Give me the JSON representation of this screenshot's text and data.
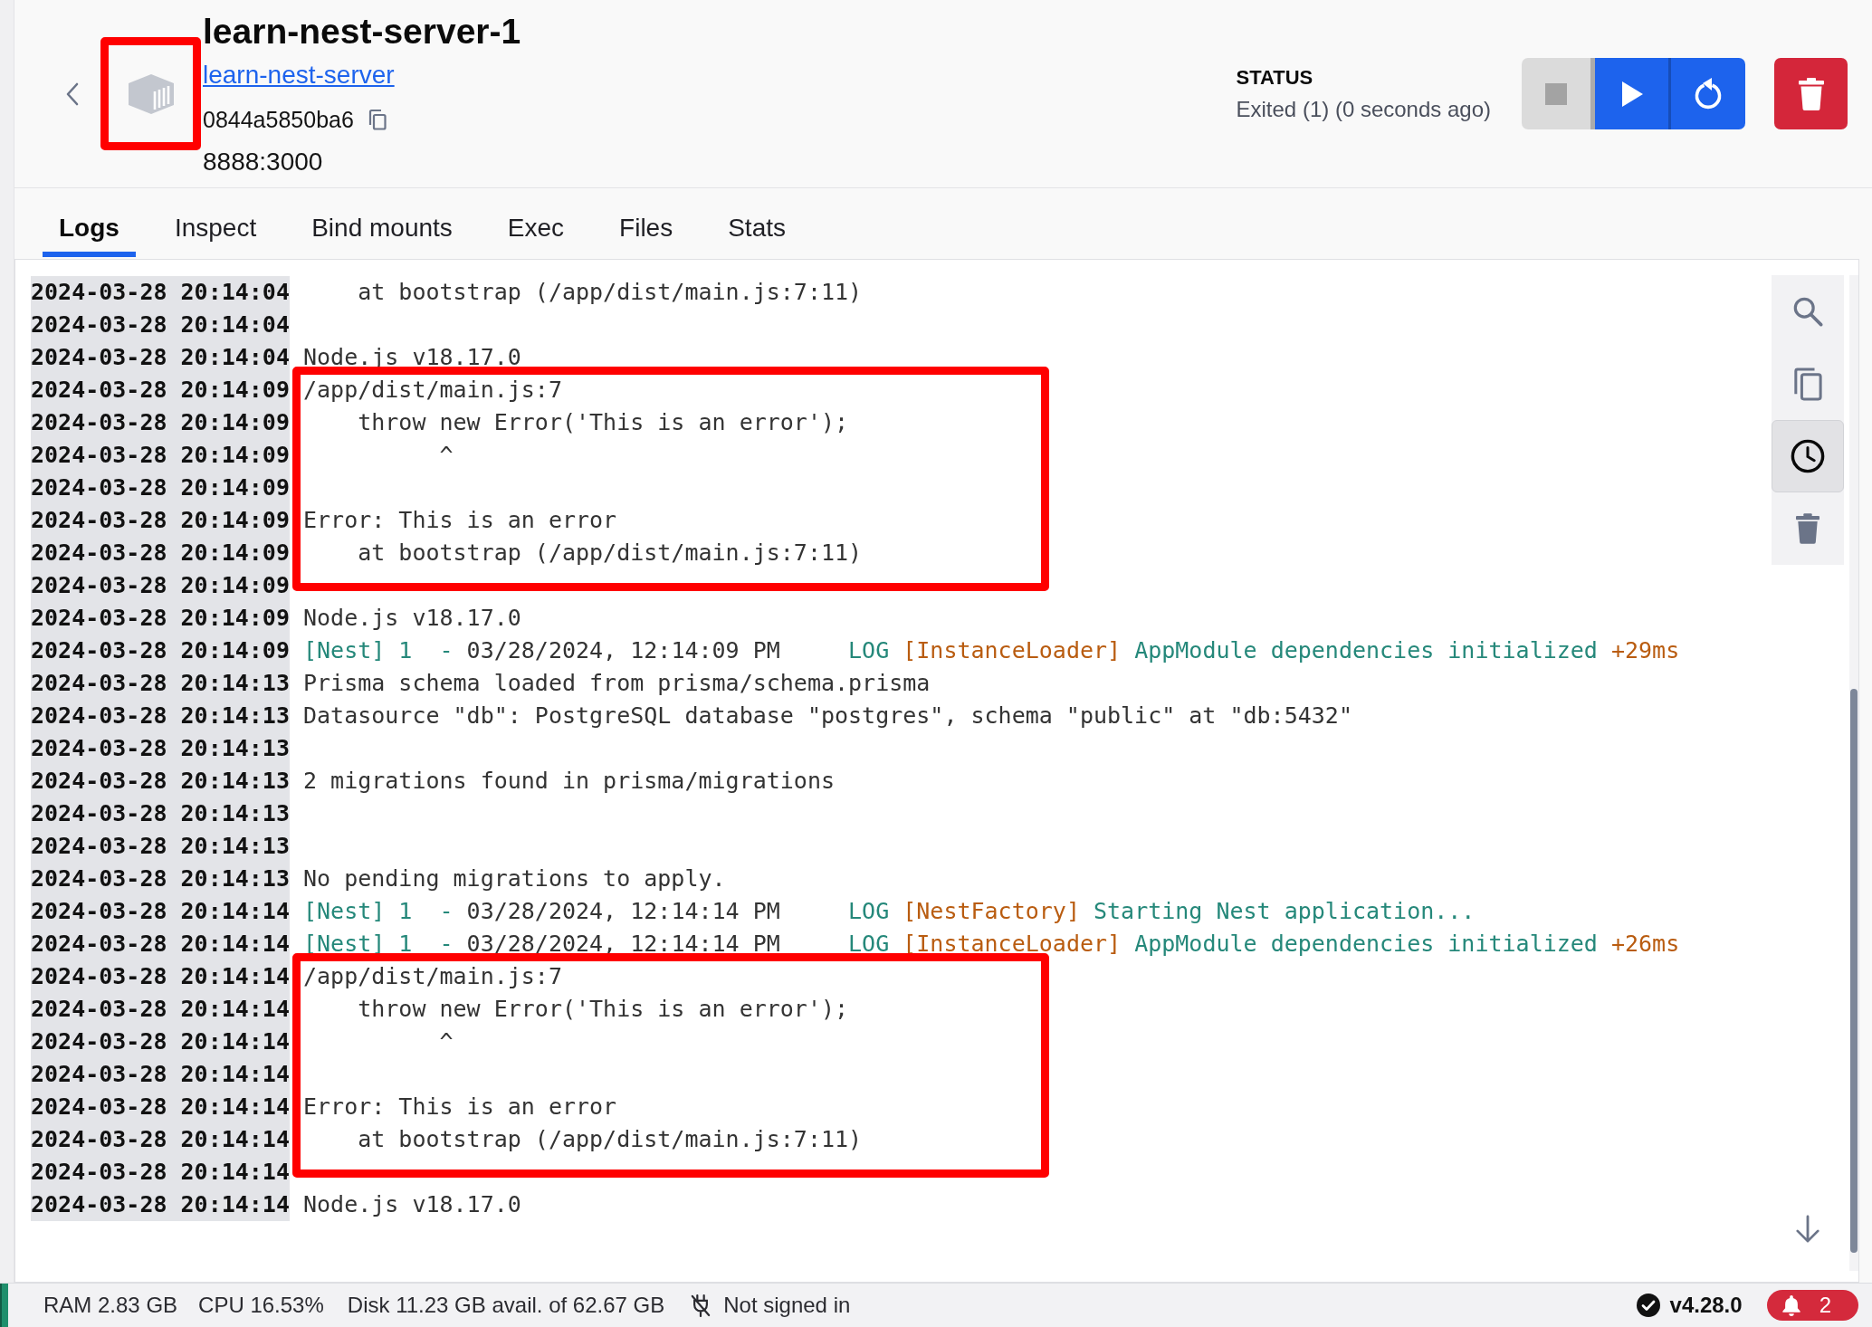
{
  "container": {
    "name": "learn-nest-server-1",
    "image": "learn-nest-server",
    "id": "0844a5850ba6",
    "ports": "8888:3000",
    "framed": true
  },
  "status": {
    "label": "STATUS",
    "value": "Exited (1) (0 seconds ago)"
  },
  "actions": [
    {
      "kind": "stop",
      "disabled": true
    },
    {
      "kind": "start",
      "disabled": false
    },
    {
      "kind": "restart",
      "disabled": false
    },
    {
      "kind": "delete",
      "disabled": false
    }
  ],
  "tabs": [
    {
      "label": "Logs",
      "selected": true
    },
    {
      "label": "Inspect",
      "selected": false
    },
    {
      "label": "Bind mounts",
      "selected": false
    },
    {
      "label": "Exec",
      "selected": false
    },
    {
      "label": "Files",
      "selected": false
    },
    {
      "label": "Stats",
      "selected": false
    }
  ],
  "log_tools": [
    {
      "kind": "search",
      "selected": false
    },
    {
      "kind": "copy",
      "selected": false
    },
    {
      "kind": "timestamps",
      "selected": true
    },
    {
      "kind": "clear",
      "selected": false
    }
  ],
  "log_blocks": [
    {
      "framed": false,
      "lines": [
        {
          "time": "2024-03-28 20:14:04",
          "text": "    at bootstrap (/app/dist/main.js:7:11)"
        },
        {
          "time": "2024-03-28 20:14:04"
        },
        {
          "time": "2024-03-28 20:14:04",
          "text": "Node.js v18.17.0"
        }
      ]
    },
    {
      "framed": true,
      "lines": [
        {
          "time": "2024-03-28 20:14:09",
          "text": "/app/dist/main.js:7"
        },
        {
          "time": "2024-03-28 20:14:09",
          "text": "    throw new Error('This is an error');"
        },
        {
          "time": "2024-03-28 20:14:09",
          "text": "          ^"
        },
        {
          "time": "2024-03-28 20:14:09"
        },
        {
          "time": "2024-03-28 20:14:09",
          "text": "Error: This is an error"
        },
        {
          "time": "2024-03-28 20:14:09",
          "text": "    at bootstrap (/app/dist/main.js:7:11)"
        },
        {
          "time": "2024-03-28 20:14:09"
        }
      ]
    },
    {
      "framed": false,
      "lines": [
        {
          "time": "2024-03-28 20:14:09",
          "text": "Node.js v18.17.0"
        },
        {
          "time": "2024-03-28 20:14:09",
          "parts": [
            {
              "text": "[Nest] 1  - ",
              "color": "#25887a"
            },
            {
              "text": "03/28/2024, 12:14:09 PM     "
            },
            {
              "text": "LOG ",
              "color": "#25887a"
            },
            {
              "text": "[InstanceLoader] ",
              "color": "#b95c10"
            },
            {
              "text": "AppModule dependencies initialized ",
              "color": "#25887a"
            },
            {
              "text": "+29ms",
              "color": "#b95c10"
            }
          ]
        },
        {
          "time": "2024-03-28 20:14:13",
          "text": "Prisma schema loaded from prisma/schema.prisma"
        },
        {
          "time": "2024-03-28 20:14:13",
          "text": "Datasource \"db\": PostgreSQL database \"postgres\", schema \"public\" at \"db:5432\""
        },
        {
          "time": "2024-03-28 20:14:13"
        },
        {
          "time": "2024-03-28 20:14:13",
          "text": "2 migrations found in prisma/migrations"
        },
        {
          "time": "2024-03-28 20:14:13"
        },
        {
          "time": "2024-03-28 20:14:13"
        },
        {
          "time": "2024-03-28 20:14:13",
          "text": "No pending migrations to apply."
        },
        {
          "time": "2024-03-28 20:14:14",
          "parts": [
            {
              "text": "[Nest] 1  - ",
              "color": "#25887a"
            },
            {
              "text": "03/28/2024, 12:14:14 PM     "
            },
            {
              "text": "LOG ",
              "color": "#25887a"
            },
            {
              "text": "[NestFactory] ",
              "color": "#b95c10"
            },
            {
              "text": "Starting Nest application...",
              "color": "#25887a"
            }
          ]
        },
        {
          "time": "2024-03-28 20:14:14",
          "parts": [
            {
              "text": "[Nest] 1  - ",
              "color": "#25887a"
            },
            {
              "text": "03/28/2024, 12:14:14 PM     "
            },
            {
              "text": "LOG ",
              "color": "#25887a"
            },
            {
              "text": "[InstanceLoader] ",
              "color": "#b95c10"
            },
            {
              "text": "AppModule dependencies initialized ",
              "color": "#25887a"
            },
            {
              "text": "+26ms",
              "color": "#b95c10"
            }
          ]
        }
      ]
    },
    {
      "framed": true,
      "lines": [
        {
          "time": "2024-03-28 20:14:14",
          "text": "/app/dist/main.js:7"
        },
        {
          "time": "2024-03-28 20:14:14",
          "text": "    throw new Error('This is an error');"
        },
        {
          "time": "2024-03-28 20:14:14",
          "text": "          ^"
        },
        {
          "time": "2024-03-28 20:14:14"
        },
        {
          "time": "2024-03-28 20:14:14",
          "text": "Error: This is an error"
        },
        {
          "time": "2024-03-28 20:14:14",
          "text": "    at bootstrap (/app/dist/main.js:7:11)"
        },
        {
          "time": "2024-03-28 20:14:14"
        }
      ]
    },
    {
      "framed": false,
      "lines": [
        {
          "time": "2024-03-28 20:14:14",
          "text": "Node.js v18.17.0"
        }
      ]
    }
  ],
  "status_bar": {
    "ram": "RAM 2.83 GB",
    "cpu": "CPU 16.53%",
    "disk": "Disk 11.23 GB avail. of 62.67 GB",
    "account": "Not signed in",
    "version": "v4.28.0",
    "notifications": "2"
  }
}
